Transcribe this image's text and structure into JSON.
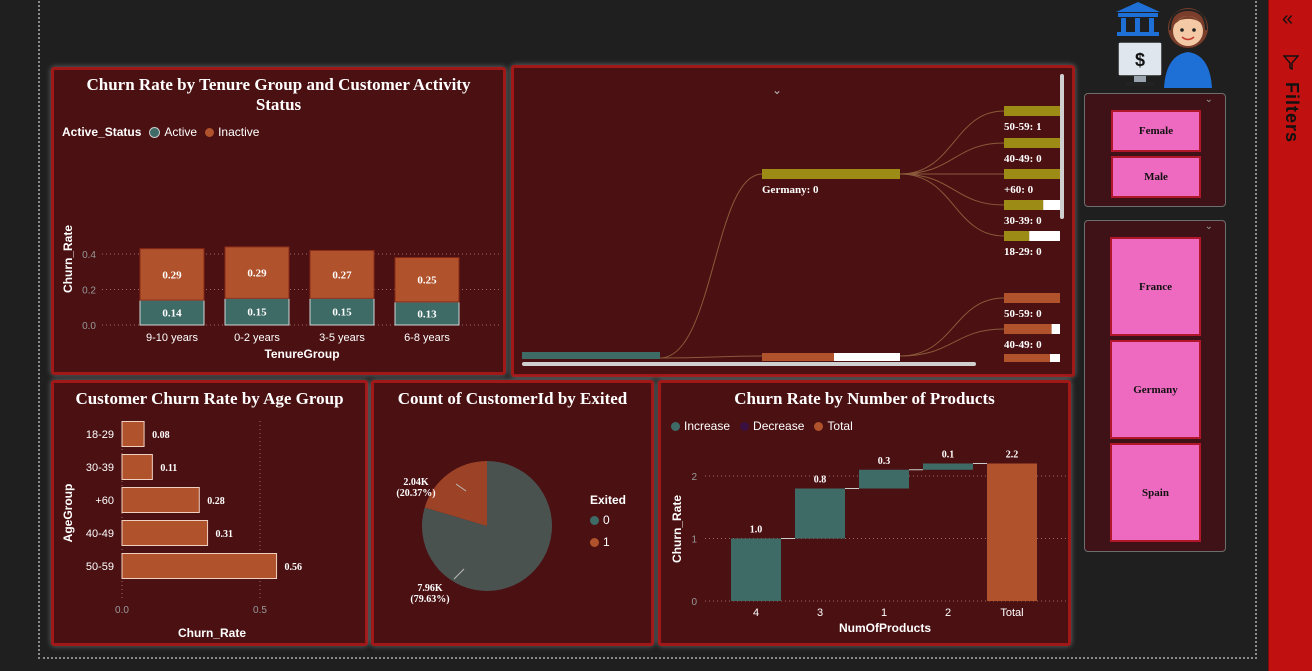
{
  "tenure_chart": {
    "title": "Churn Rate by Tenure Group and Customer Activity Status",
    "legend_title": "Active_Status",
    "legend_items": [
      {
        "label": "Active",
        "color": "#3f6b67"
      },
      {
        "label": "Inactive",
        "color": "#b0522b"
      }
    ],
    "y_ticks": [
      "0.0",
      "0.2",
      "0.4"
    ]
  },
  "age_chart": {
    "title": "Customer Churn Rate by Age Group",
    "x_ticks": [
      "0.0",
      "0.5"
    ]
  },
  "pie_chart": {
    "title": "Count of CustomerId by Exited",
    "legend_title": "Exited",
    "legend_items": [
      {
        "label": "0",
        "color": "#3f6b67"
      },
      {
        "label": "1",
        "color": "#b0522b"
      }
    ],
    "label_1_count": "2.04K",
    "label_1_pct": "(20.37%)",
    "label_0_count": "7.96K",
    "label_0_pct": "(79.63%)"
  },
  "products_chart": {
    "title": "Churn Rate by Number of Products",
    "legend_items": [
      {
        "label": "Increase",
        "color": "#3f6b67"
      },
      {
        "label": "Decrease",
        "color": "#3a1040"
      },
      {
        "label": "Total",
        "color": "#b0522b"
      }
    ],
    "y_ticks": [
      "0",
      "1",
      "2"
    ]
  },
  "decomp_tree": {
    "root_label": "Germany: 0",
    "nodes": [
      "50-59: 1",
      "40-49: 0",
      "+60: 0",
      "30-39: 0",
      "18-29: 0",
      "50-59: 0",
      "40-49: 0"
    ],
    "colors": {
      "olive": "#9c8b14",
      "orange": "#b0522b",
      "teal": "#3f6b67"
    }
  },
  "gender_slicer": {
    "options": [
      "Female",
      "Male"
    ]
  },
  "country_slicer": {
    "options": [
      "France",
      "Germany",
      "Spain"
    ]
  },
  "filters_pane": {
    "label": "Filters"
  },
  "chart_data": [
    {
      "type": "bar",
      "stacked": true,
      "title": "Churn Rate by Tenure Group and Customer Activity Status",
      "xlabel": "TenureGroup",
      "ylabel": "Churn_Rate",
      "categories": [
        "9-10 years",
        "0-2 years",
        "3-5 years",
        "6-8 years"
      ],
      "series": [
        {
          "name": "Active",
          "values": [
            0.14,
            0.15,
            0.15,
            0.13
          ]
        },
        {
          "name": "Inactive",
          "values": [
            0.29,
            0.29,
            0.27,
            0.25
          ]
        }
      ],
      "ylim": [
        0,
        0.45
      ],
      "legend": "top-left",
      "grid": true
    },
    {
      "type": "bar",
      "orientation": "horizontal",
      "title": "Customer Churn Rate by Age Group",
      "xlabel": "Churn_Rate",
      "ylabel": "AgeGroup",
      "categories": [
        "18-29",
        "30-39",
        "+60",
        "40-49",
        "50-59"
      ],
      "values": [
        0.08,
        0.11,
        0.28,
        0.31,
        0.56
      ],
      "xlim": [
        0,
        0.6
      ],
      "grid": true
    },
    {
      "type": "pie",
      "title": "Count of CustomerId by Exited",
      "categories": [
        "0",
        "1"
      ],
      "values": [
        7960,
        2040
      ],
      "percentages": [
        79.63,
        20.37
      ],
      "legend": "right"
    },
    {
      "type": "bar",
      "subtype": "waterfall",
      "title": "Churn Rate by Number of Products",
      "xlabel": "NumOfProducts",
      "ylabel": "Churn_Rate",
      "categories": [
        "4",
        "3",
        "1",
        "2",
        "Total"
      ],
      "values": [
        1.0,
        0.8,
        0.3,
        0.1,
        2.2
      ],
      "ylim": [
        0,
        2.4
      ],
      "legend": "top-left",
      "grid": true
    }
  ]
}
